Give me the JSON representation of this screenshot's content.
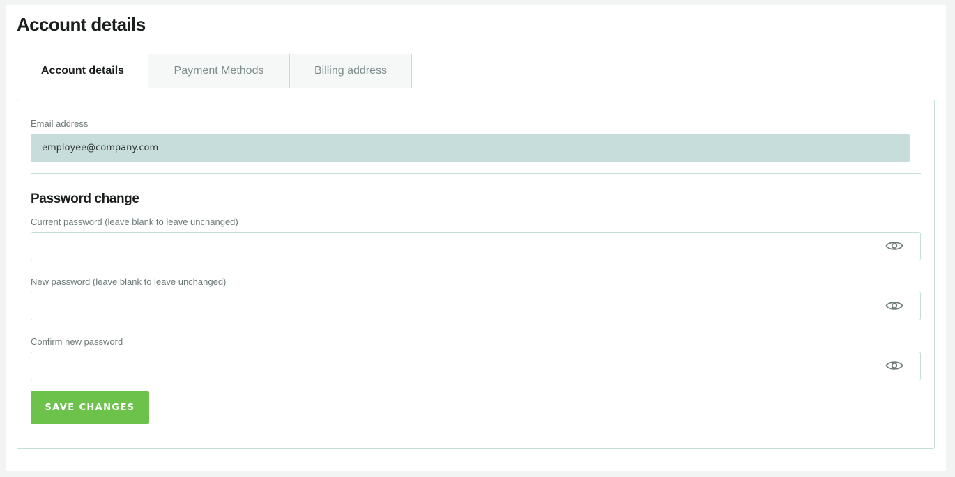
{
  "page": {
    "title": "Account details"
  },
  "tabs": [
    {
      "label": "Account details",
      "active": true
    },
    {
      "label": "Payment Methods",
      "active": false
    },
    {
      "label": "Billing address",
      "active": false
    }
  ],
  "form": {
    "email": {
      "label": "Email address",
      "value": "employee@company.com"
    },
    "password_section": {
      "title": "Password change",
      "current": {
        "label": "Current password (leave blank to leave unchanged)",
        "value": "",
        "icon": "eye-icon"
      },
      "new": {
        "label": "New password (leave blank to leave unchanged)",
        "value": "",
        "icon": "eye-icon"
      },
      "confirm": {
        "label": "Confirm new password",
        "value": "",
        "icon": "eye-icon"
      }
    },
    "save_label": "SAVE CHANGES"
  },
  "colors": {
    "accent_green": "#6cc24a",
    "border": "#c6dedb",
    "readonly_field_bg": "#c7dddb"
  }
}
